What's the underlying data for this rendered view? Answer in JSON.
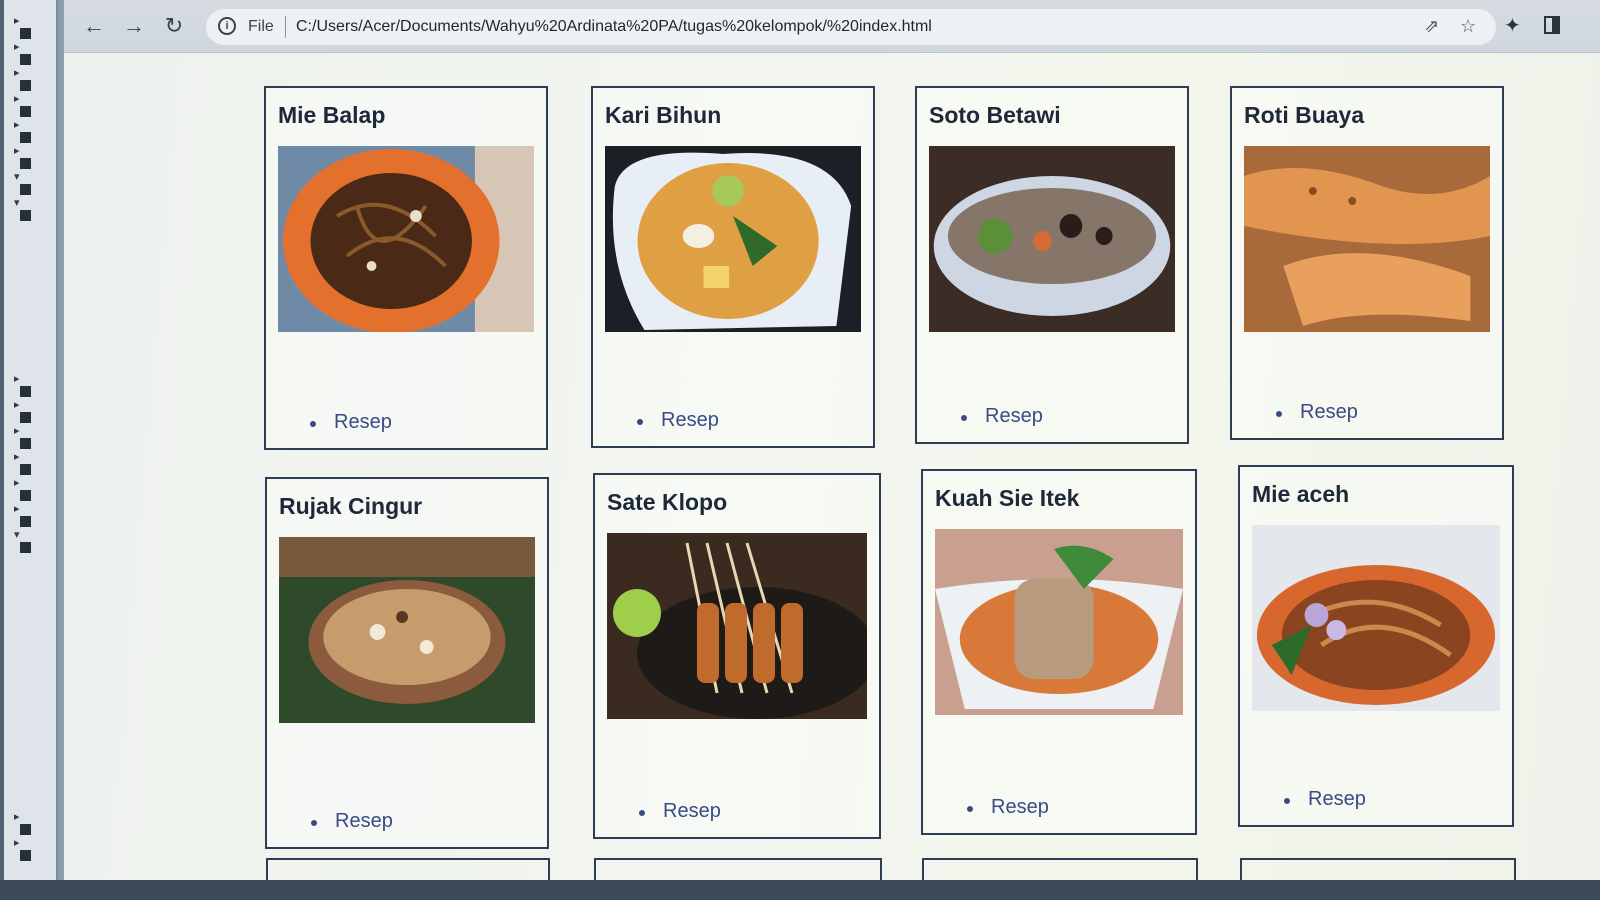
{
  "browser": {
    "scheme_label": "File",
    "url": "C:/Users/Acer/Documents/Wahyu%20Ardinata%20PA/tugas%20kelompok/%20index.html",
    "icons": {
      "back": "arrow-left-icon",
      "forward": "arrow-right-icon",
      "reload": "reload-icon",
      "info": "info-icon",
      "share": "share-icon",
      "bookmark": "star-icon",
      "extensions": "puzzle-icon",
      "window": "sidebar-icon"
    }
  },
  "cards": [
    {
      "title": "Mie Balap",
      "link": "Resep"
    },
    {
      "title": "Kari Bihun",
      "link": "Resep"
    },
    {
      "title": "Soto Betawi",
      "link": "Resep"
    },
    {
      "title": "Roti Buaya",
      "link": "Resep"
    },
    {
      "title": "Rujak Cingur",
      "link": "Resep"
    },
    {
      "title": "Sate Klopo",
      "link": "Resep"
    },
    {
      "title": "Kuah Sie Itek",
      "link": "Resep"
    },
    {
      "title": "Mie aceh",
      "link": "Resep"
    }
  ],
  "colors": {
    "card_border": "#2e3d56",
    "link": "#3b4a84",
    "title": "#1d2838"
  }
}
